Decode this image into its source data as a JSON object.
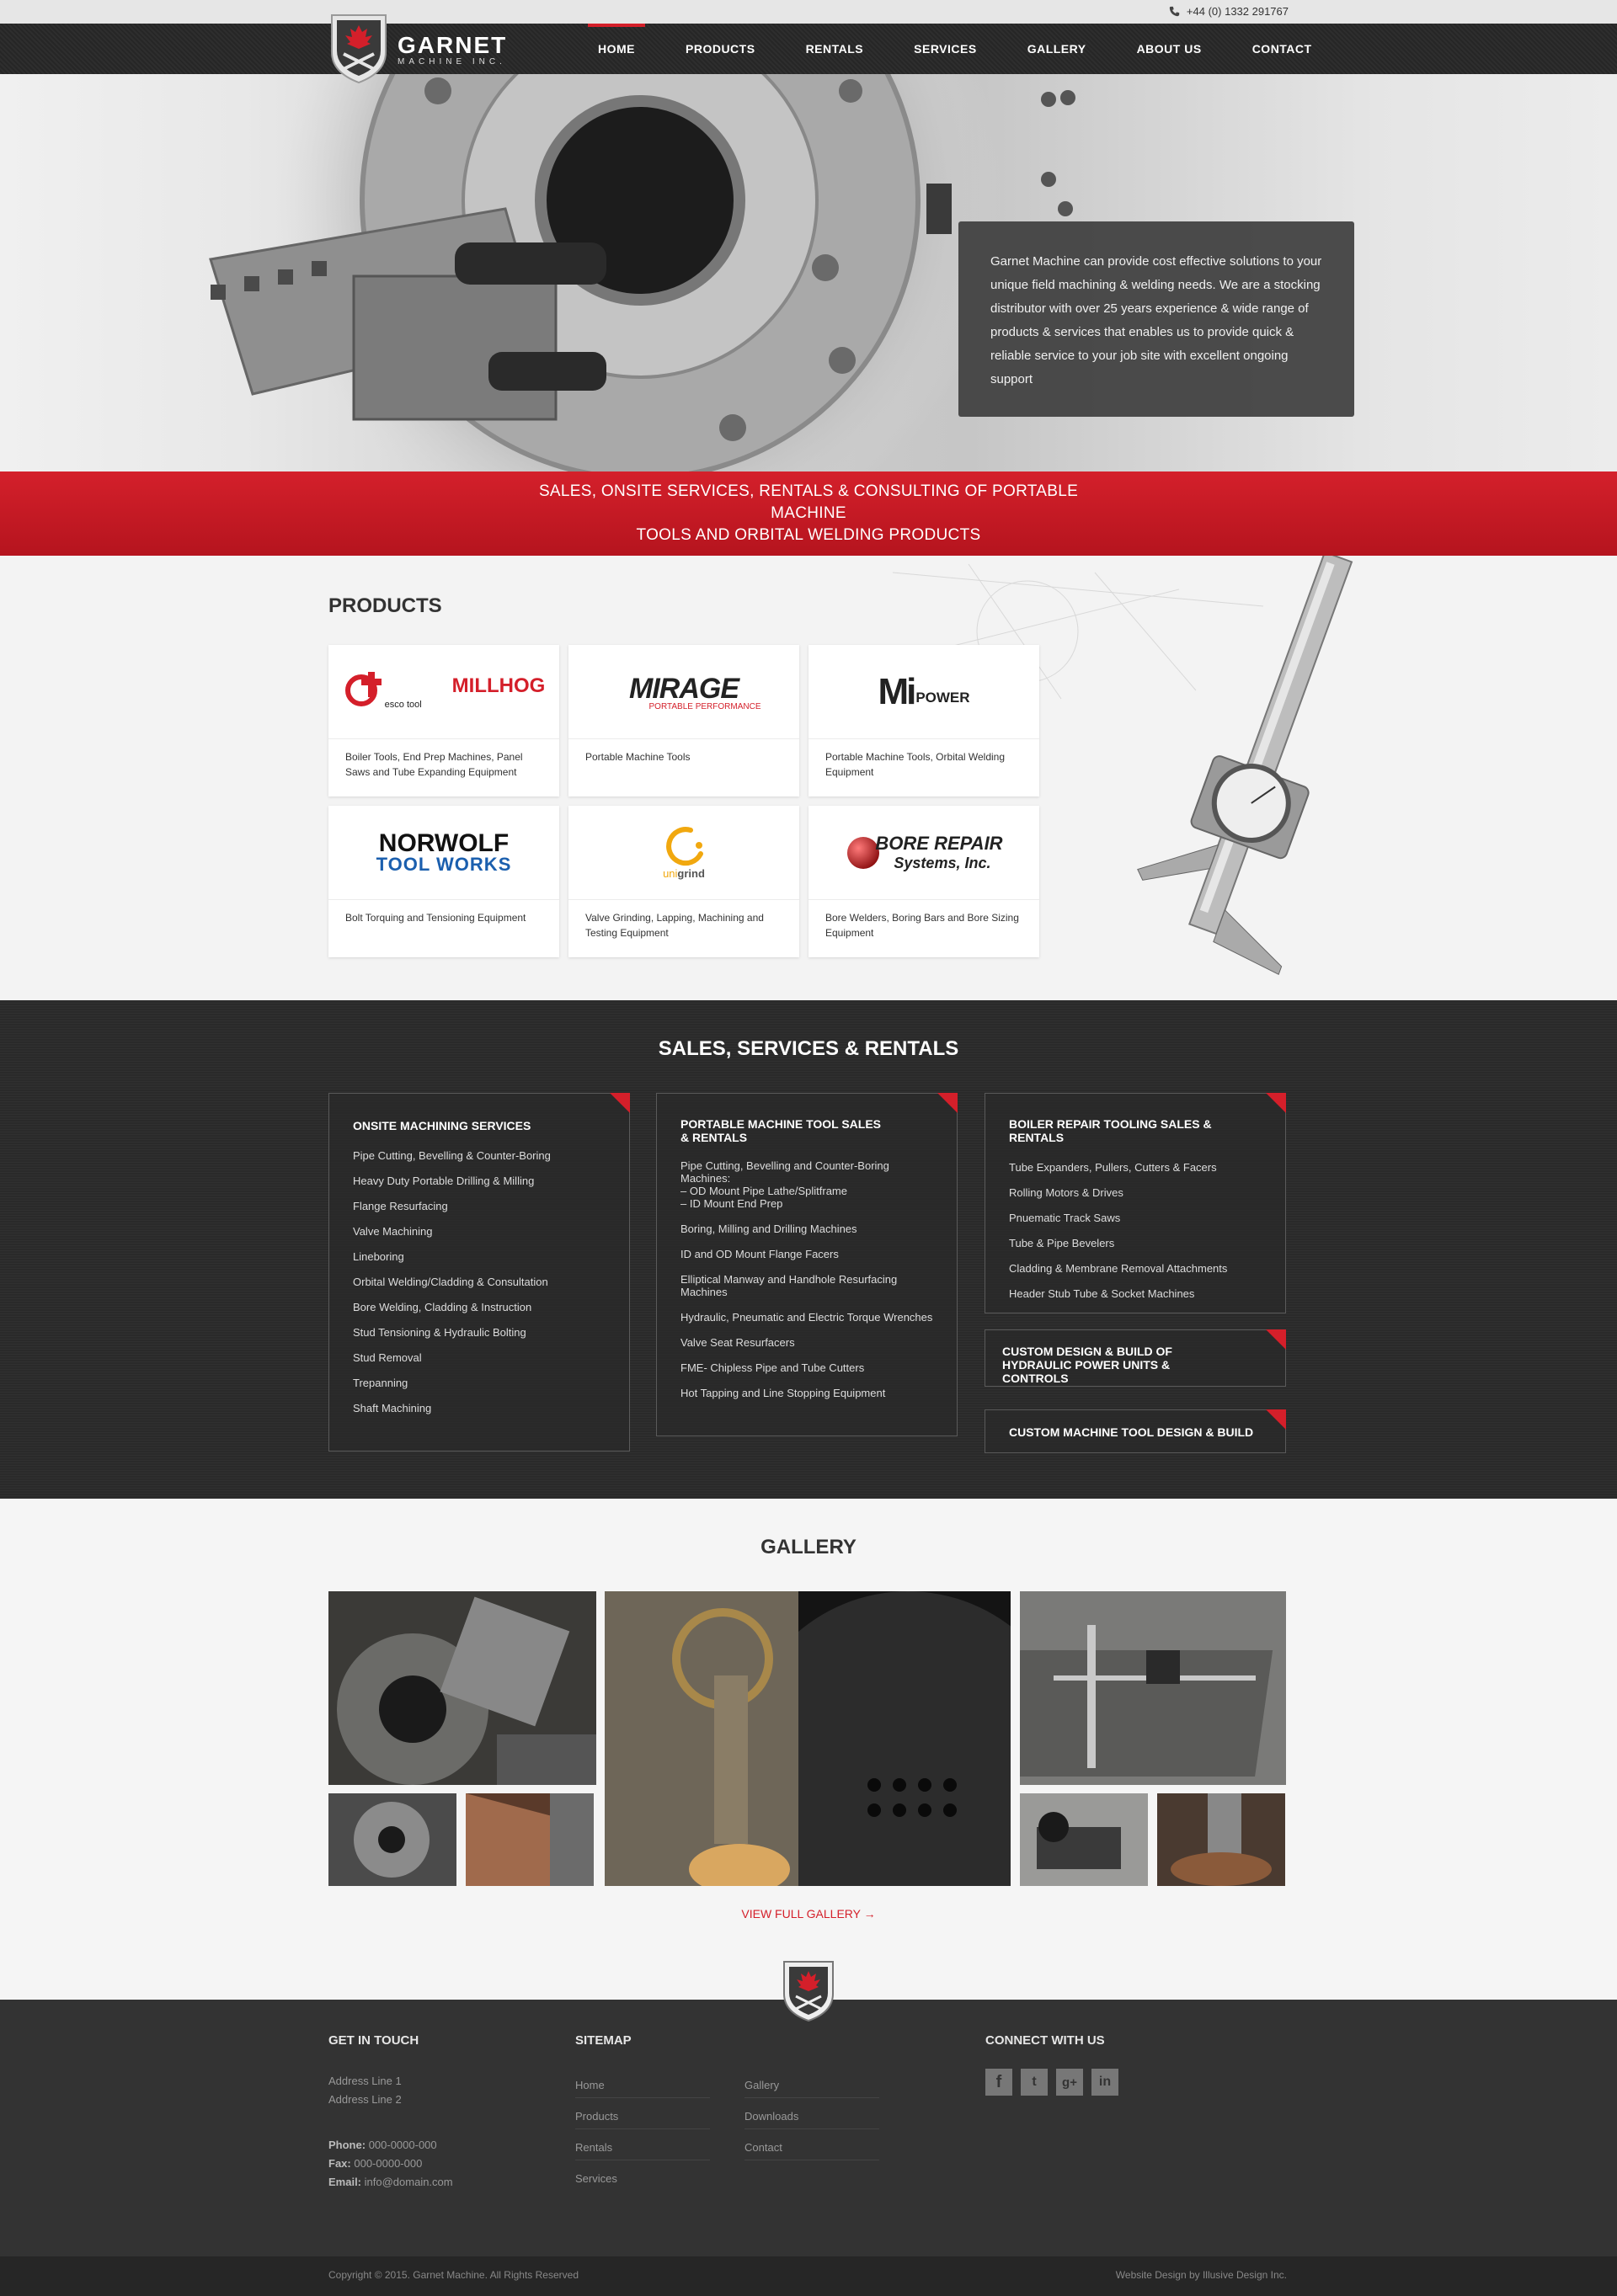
{
  "topbar": {
    "phone": "+44 (0) 1332 291767"
  },
  "logo": {
    "name": "GARNET",
    "sub": "MACHINE INC."
  },
  "nav": [
    {
      "label": "HOME",
      "active": true
    },
    {
      "label": "PRODUCTS"
    },
    {
      "label": "RENTALS"
    },
    {
      "label": "SERVICES"
    },
    {
      "label": "GALLERY"
    },
    {
      "label": "ABOUT US"
    },
    {
      "label": "CONTACT"
    }
  ],
  "hero": {
    "text": "Garnet Machine can provide cost effective solutions to your unique field machining & welding needs. We are a stocking distributor with over 25 years experience & wide range of products & services that enables us to provide quick & reliable service to your job site with excellent ongoing support"
  },
  "banner": {
    "line1": "SALES, ONSITE SERVICES, RENTALS & CONSULTING OF PORTABLE MACHINE",
    "line2": "TOOLS AND ORBITAL WELDING PRODUCTS"
  },
  "products": {
    "title": "PRODUCTS",
    "items": [
      {
        "brand": "MILLHOG",
        "brand2": "esco tool",
        "desc": "Boiler Tools, End Prep Machines, Panel Saws and Tube Expanding Equipment"
      },
      {
        "brand": "MIRAGE",
        "brand2": "PORTABLE PERFORMANCE",
        "desc": "Portable Machine Tools"
      },
      {
        "brand": "Mi",
        "brand2": "POWER",
        "desc": "Portable Machine Tools, Orbital Welding Equipment"
      },
      {
        "brand": "NORWOLF",
        "brand2": "TOOL WORKS",
        "desc": "Bolt Torquing and Tensioning Equipment"
      },
      {
        "brand": "uni",
        "brand2": "grind",
        "desc": "Valve Grinding, Lapping, Machining and Testing Equipment"
      },
      {
        "brand": "BORE REPAIR",
        "brand2": "Systems, Inc.",
        "desc": "Bore Welders, Boring Bars and Bore Sizing Equipment"
      }
    ]
  },
  "sales": {
    "title": "SALES, SERVICES & RENTALS",
    "boxes": [
      {
        "title": "ONSITE MACHINING SERVICES",
        "items": [
          "Pipe Cutting, Bevelling & Counter-Boring",
          "Heavy Duty Portable Drilling & Milling",
          "Flange Resurfacing",
          "Valve Machining",
          "Lineboring",
          "Orbital Welding/Cladding & Consultation",
          "Bore Welding, Cladding & Instruction",
          "Stud Tensioning & Hydraulic Bolting",
          "Stud Removal",
          "Trepanning",
          "Shaft Machining"
        ]
      },
      {
        "title": "PORTABLE MACHINE TOOL SALES & RENTALS",
        "items": [
          "Pipe Cutting, Bevelling and Counter-Boring Machines:\n– OD Mount Pipe Lathe/Splitframe\n– ID Mount End Prep",
          "Boring, Milling and Drilling Machines",
          "ID and OD Mount Flange Facers",
          "Elliptical Manway and Handhole Resurfacing Machines",
          "Hydraulic, Pneumatic and Electric Torque Wrenches",
          "Valve Seat Resurfacers",
          "FME- Chipless Pipe and Tube Cutters",
          "Hot Tapping and Line Stopping Equipment"
        ]
      },
      {
        "title": "BOILER REPAIR TOOLING SALES & RENTALS",
        "items": [
          "Tube Expanders, Pullers, Cutters & Facers",
          "Rolling Motors & Drives",
          "Pnuematic Track Saws",
          "Tube & Pipe Bevelers",
          "Cladding & Membrane Removal Attachments",
          "Header Stub Tube & Socket Machines"
        ]
      },
      {
        "title": "CUSTOM DESIGN & BUILD OF HYDRAULIC POWER UNITS & CONTROLS",
        "items": []
      },
      {
        "title": "CUSTOM MACHINE TOOL DESIGN & BUILD",
        "items": []
      }
    ]
  },
  "gallery": {
    "title": "GALLERY",
    "view_all": "VIEW FULL GALLERY →"
  },
  "footer": {
    "contact_title": "GET IN TOUCH",
    "address1": "Address Line 1",
    "address2": "Address Line 2",
    "phone_label": "Phone:",
    "phone": "000-0000-000",
    "fax_label": "Fax:",
    "fax": "000-0000-000",
    "email_label": "Email:",
    "email": "info@domain.com",
    "sitemap_title": "SITEMAP",
    "sitemap": [
      "Home",
      "Products",
      "Rentals",
      "Services",
      "Gallery",
      "Downloads",
      "Contact"
    ],
    "connect_title": "CONNECT WITH US",
    "social": [
      "f",
      "t",
      "g+",
      "in"
    ],
    "copyright": "Copyright © 2015. Garnet Machine. All Rights Reserved",
    "credit": "Website Design by Illusive Design Inc."
  },
  "colors": {
    "accent": "#d41f2a",
    "dark": "#2e2e2e",
    "footer": "#333333"
  }
}
